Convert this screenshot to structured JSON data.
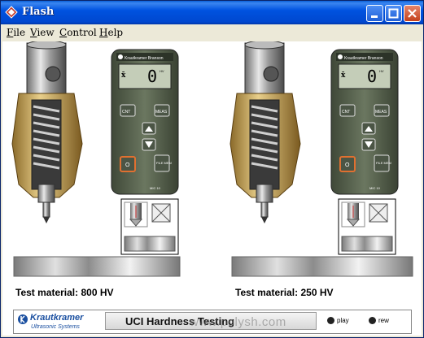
{
  "window": {
    "title": "Flash"
  },
  "menu": [
    {
      "ul": "F",
      "rest": "ile"
    },
    {
      "ul": "V",
      "rest": "iew"
    },
    {
      "ul": "C",
      "rest": "ontrol"
    },
    {
      "ul": "H",
      "rest": "elp"
    }
  ],
  "panels": [
    {
      "material_label": "Test material: 800 HV"
    },
    {
      "material_label": "Test material: 250 HV"
    }
  ],
  "device": {
    "brand": "Krautkramer Branson",
    "display_value": "0",
    "display_unit": "HV",
    "mean_symbol": "x̄",
    "buttons": {
      "cnt": "CNT",
      "meas": "MEAS",
      "on": "O",
      "file": "FILE MEM"
    },
    "model": "MIC 10"
  },
  "footer": {
    "logo": "Krautkramer",
    "logo_sub": "Ultrasonic Systems",
    "title": "UCI Hardness Testing",
    "play_label": "play",
    "rew_label": "rew"
  },
  "watermark": "www.polysh.com",
  "colors": {
    "titlebar": "#0053e0",
    "brand_blue": "#1a4fa0",
    "device_body": "#5a6650"
  }
}
